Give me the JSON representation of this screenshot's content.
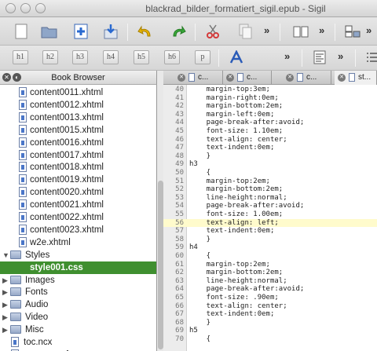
{
  "window": {
    "title": "blackrad_bilder_formatiert_sigil.epub - Sigil"
  },
  "toolbar_headings": [
    "h1",
    "h2",
    "h3",
    "h4",
    "h5",
    "h6",
    "p"
  ],
  "toolbar_overflow": "»",
  "book_browser": {
    "title": "Book Browser",
    "items": [
      {
        "label": "content0011.xhtml",
        "kind": "file"
      },
      {
        "label": "content0012.xhtml",
        "kind": "file"
      },
      {
        "label": "content0013.xhtml",
        "kind": "file"
      },
      {
        "label": "content0015.xhtml",
        "kind": "file"
      },
      {
        "label": "content0016.xhtml",
        "kind": "file"
      },
      {
        "label": "content0017.xhtml",
        "kind": "file"
      },
      {
        "label": "content0018.xhtml",
        "kind": "file"
      },
      {
        "label": "content0019.xhtml",
        "kind": "file"
      },
      {
        "label": "content0020.xhtml",
        "kind": "file"
      },
      {
        "label": "content0021.xhtml",
        "kind": "file"
      },
      {
        "label": "content0022.xhtml",
        "kind": "file"
      },
      {
        "label": "content0023.xhtml",
        "kind": "file"
      },
      {
        "label": "w2e.xhtml",
        "kind": "file"
      },
      {
        "label": "Styles",
        "kind": "folder-open"
      },
      {
        "label": "style001.css",
        "kind": "selected"
      },
      {
        "label": "Images",
        "kind": "folder"
      },
      {
        "label": "Fonts",
        "kind": "folder"
      },
      {
        "label": "Audio",
        "kind": "folder"
      },
      {
        "label": "Video",
        "kind": "folder"
      },
      {
        "label": "Misc",
        "kind": "folder"
      },
      {
        "label": "toc.ncx",
        "kind": "root-file"
      },
      {
        "label": "content.opf",
        "kind": "root-file"
      }
    ]
  },
  "tabs": [
    {
      "label": "c..."
    },
    {
      "label": "c..."
    },
    {
      "label": "c..."
    },
    {
      "label": "st..."
    }
  ],
  "editor": {
    "highlight_line": "56",
    "lines": [
      {
        "n": "40",
        "code": "    margin-top:3em;"
      },
      {
        "n": "41",
        "code": "    margin-right:0em;"
      },
      {
        "n": "42",
        "code": "    margin-bottom:2em;"
      },
      {
        "n": "43",
        "code": "    margin-left:0em;"
      },
      {
        "n": "44",
        "code": "    page-break-after:avoid;"
      },
      {
        "n": "45",
        "code": "    font-size: 1.10em;"
      },
      {
        "n": "46",
        "code": "    text-align: center;"
      },
      {
        "n": "47",
        "code": "    text-indent:0em;"
      },
      {
        "n": "48",
        "code": "    }"
      },
      {
        "n": "49",
        "code": "h3"
      },
      {
        "n": "50",
        "code": "    {"
      },
      {
        "n": "51",
        "code": "    margin-top:2em;"
      },
      {
        "n": "52",
        "code": "    margin-bottom:2em;"
      },
      {
        "n": "53",
        "code": "    line-height:normal;"
      },
      {
        "n": "54",
        "code": "    page-break-after:avoid;"
      },
      {
        "n": "55",
        "code": "    font-size: 1.00em;"
      },
      {
        "n": "56",
        "code": "    text-align: left;"
      },
      {
        "n": "57",
        "code": "    text-indent:0em;"
      },
      {
        "n": "58",
        "code": "    }"
      },
      {
        "n": "59",
        "code": "h4"
      },
      {
        "n": "60",
        "code": "    {"
      },
      {
        "n": "61",
        "code": "    margin-top:2em;"
      },
      {
        "n": "62",
        "code": "    margin-bottom:2em;"
      },
      {
        "n": "63",
        "code": "    line-height:normal;"
      },
      {
        "n": "64",
        "code": "    page-break-after:avoid;"
      },
      {
        "n": "65",
        "code": "    font-size: .90em;"
      },
      {
        "n": "66",
        "code": "    text-align: center;"
      },
      {
        "n": "67",
        "code": "    text-indent:0em;"
      },
      {
        "n": "68",
        "code": "    }"
      },
      {
        "n": "69",
        "code": "h5"
      },
      {
        "n": "70",
        "code": "    {"
      }
    ]
  },
  "colors": {
    "selection": "#3f8f2f",
    "highlight": "#fffbcc"
  }
}
